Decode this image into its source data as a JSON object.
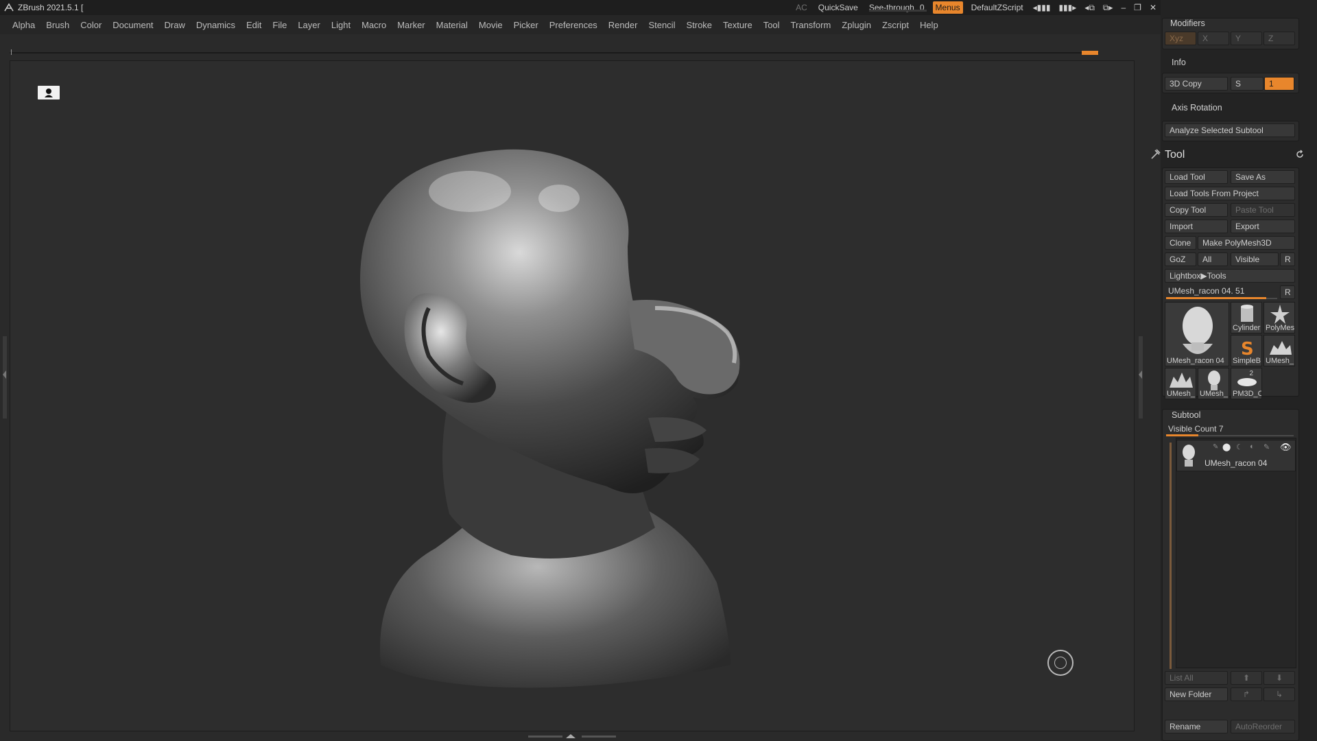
{
  "titlebar": {
    "app_title": "ZBrush 2021.5.1 [",
    "ac_label": "AC",
    "quicksave_label": "QuickSave",
    "see_through_label": "See-through",
    "see_through_value": "0",
    "see_through_level": 0.1,
    "menus_label": "Menus",
    "script_label": "DefaultZScript"
  },
  "menu": {
    "items": [
      "Alpha",
      "Brush",
      "Color",
      "Document",
      "Draw",
      "Dynamics",
      "Edit",
      "File",
      "Layer",
      "Light",
      "Macro",
      "Marker",
      "Material",
      "Movie",
      "Picker",
      "Preferences",
      "Render",
      "Stencil",
      "Stroke",
      "Texture",
      "Tool",
      "Transform",
      "Zplugin",
      "Zscript",
      "Help"
    ]
  },
  "tray": {
    "modifiers": {
      "title": "Modifiers",
      "axes": [
        "Xyz",
        "X",
        "Y",
        "Z"
      ]
    },
    "info_title": "Info",
    "copy3d_label": "3D Copy",
    "s_label": "S",
    "s_value": "1",
    "axis_rotation_title": "Axis Rotation",
    "analyze_label": "Analyze Selected Subtool",
    "tool": {
      "title": "Tool",
      "load_tool": "Load Tool",
      "save_as": "Save As",
      "load_from_project": "Load Tools From Project",
      "copy_tool": "Copy Tool",
      "paste_tool": "Paste Tool",
      "import": "Import",
      "export": "Export",
      "clone": "Clone",
      "make_polymesh": "Make PolyMesh3D",
      "goz": "GoZ",
      "all": "All",
      "visible": "Visible",
      "r": "R",
      "lightbox": "Lightbox▶Tools",
      "current_tool": "UMesh_racon 04. 51",
      "current_tool_level": 0.9,
      "thumbs": [
        {
          "label": "UMesh_racon 04"
        },
        {
          "label": "Cylinder"
        },
        {
          "label": "PolyMes"
        },
        {
          "label": "SimpleB"
        },
        {
          "label": "UMesh_"
        },
        {
          "label": "UMesh_"
        },
        {
          "label": "UMesh_"
        },
        {
          "label": "PM3D_C"
        }
      ],
      "badge_count": "2"
    },
    "subtool": {
      "title": "Subtool",
      "visible_count": "Visible Count 7",
      "visible_count_level": 0.25,
      "item_name": "UMesh_racon 04",
      "list_all": "List All",
      "new_folder": "New Folder",
      "rename": "Rename",
      "autoreorder": "AutoReorder"
    }
  },
  "colors": {
    "accent": "#e8862c",
    "background": "#2a2a2a",
    "panel": "#2c2c2c",
    "text": "#c8c8c8"
  }
}
